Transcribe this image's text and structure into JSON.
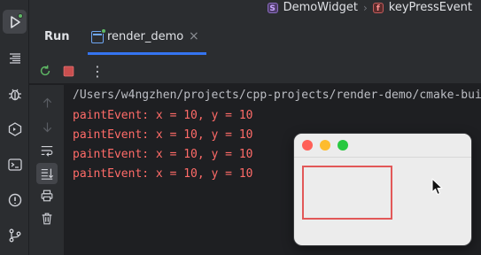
{
  "breadcrumbs": {
    "items": [
      {
        "icon": "struct-icon",
        "badge": "S",
        "label": "DemoWidget"
      },
      {
        "icon": "function-icon",
        "badge": "f",
        "label": "keyPressEvent"
      }
    ],
    "separator": "›"
  },
  "run_panel": {
    "title": "Run",
    "tab": {
      "label": "render_demo",
      "close": "×"
    }
  },
  "toolbar": {
    "icons": [
      "rerun-icon",
      "stop-icon",
      "more-options-icon"
    ],
    "more_label": "⋮"
  },
  "side_actions": [
    "scroll-up-icon",
    "scroll-down-icon",
    "soft-wrap-icon",
    "scroll-to-end-icon",
    "print-icon",
    "trash-icon"
  ],
  "left_tools": [
    "run-icon",
    "structure-icon",
    "debug-icon",
    "services-icon",
    "terminal-icon",
    "problems-icon",
    "git-icon"
  ],
  "console": {
    "path_line": "/Users/w4ngzhen/projects/cpp-projects/render-demo/cmake-buil",
    "output": [
      "paintEvent: x = 10, y = 10",
      "paintEvent: x = 10, y = 10",
      "paintEvent: x = 10, y = 10",
      "paintEvent: x = 10, y = 10"
    ]
  },
  "app_window": {
    "traffic_lights": {
      "close": "#ff5f57",
      "minimize": "#febc2e",
      "zoom": "#28c840"
    },
    "rect_color": "#e25858"
  },
  "colors": {
    "accent": "#3574f0",
    "error_text": "#ff6b68",
    "run_active": "#5fb865"
  }
}
